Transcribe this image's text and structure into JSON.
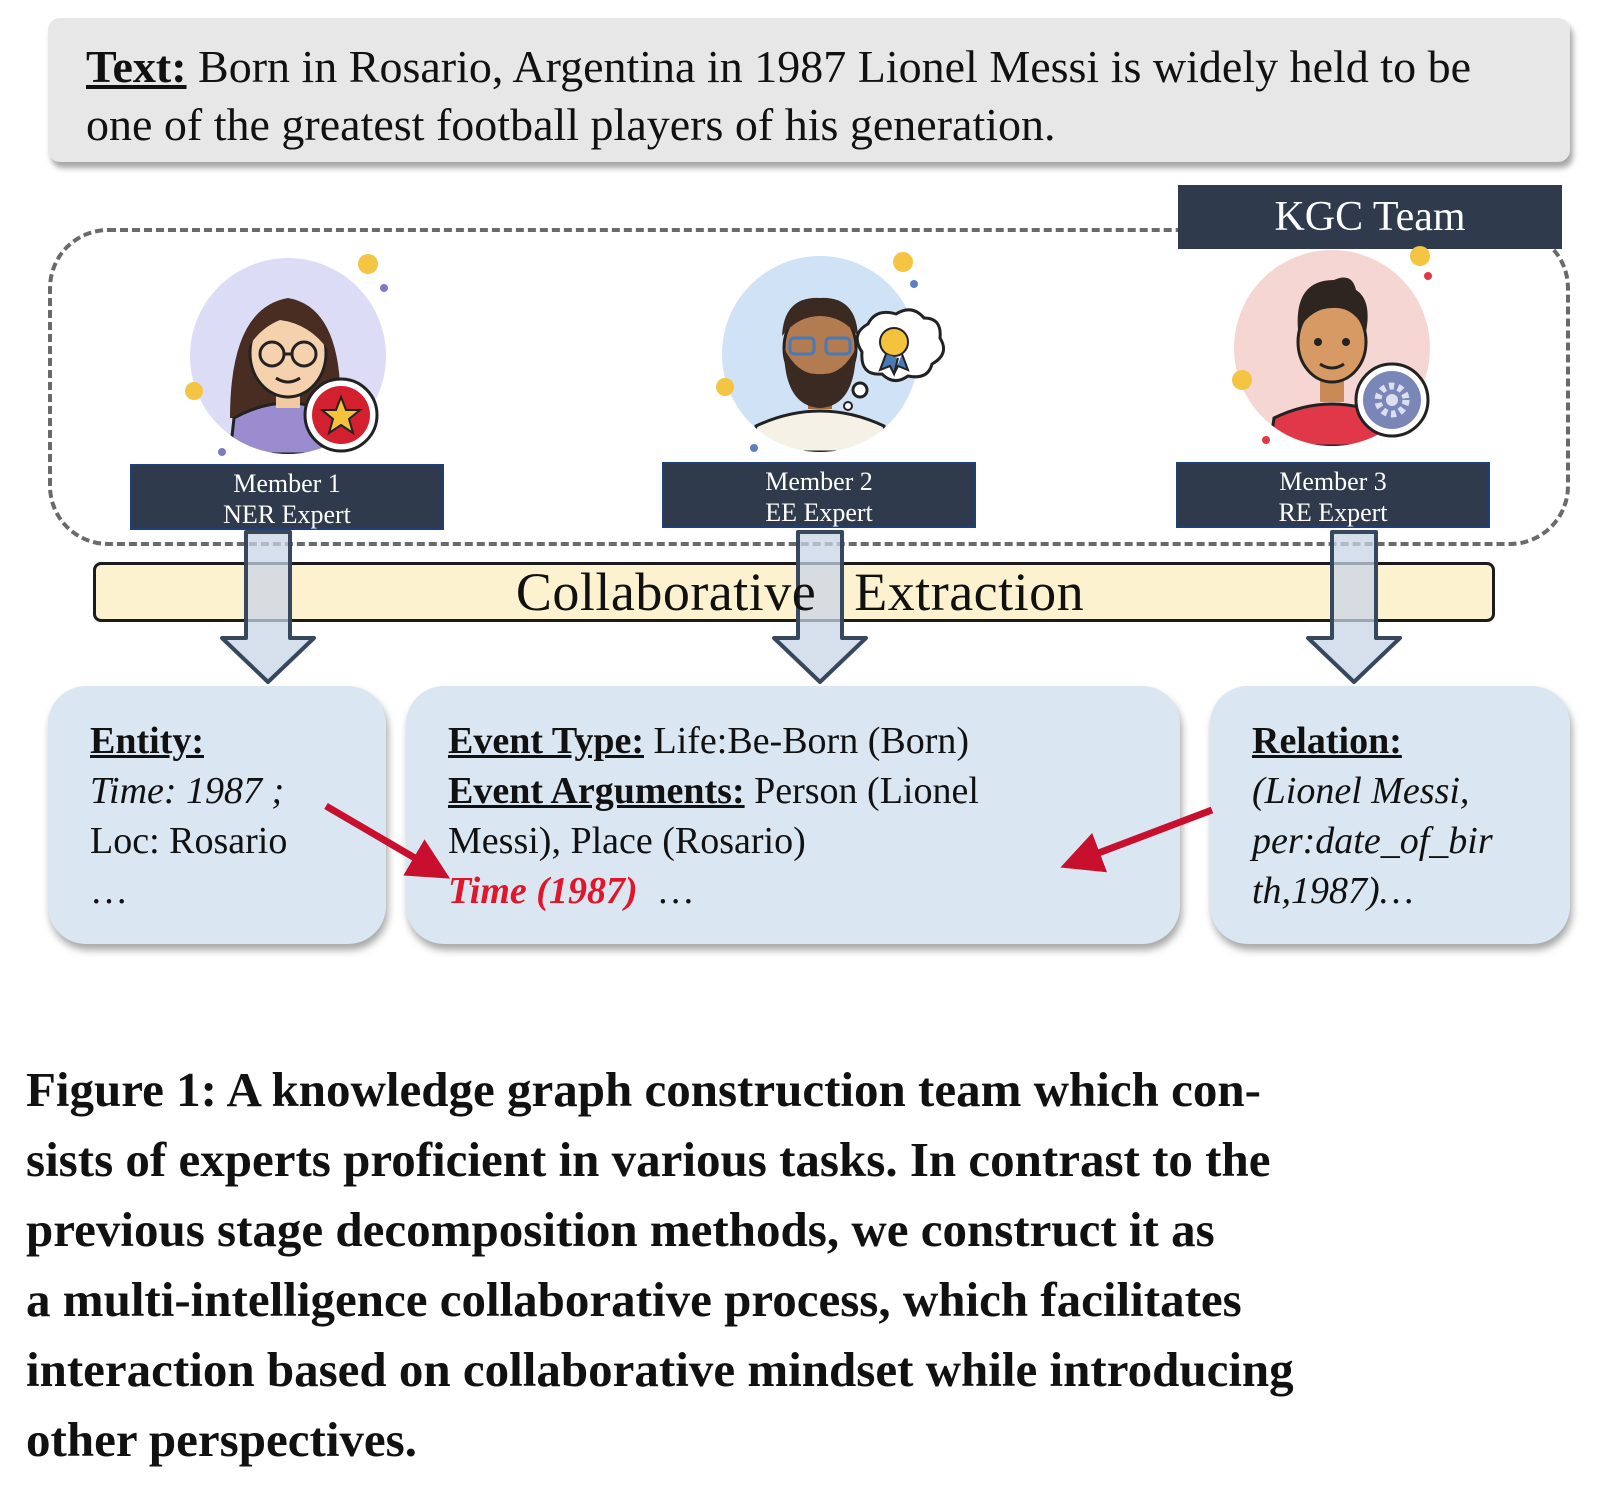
{
  "text_box": {
    "label": "Text:",
    "body": " Born in Rosario, Argentina in 1987 Lionel Messi is widely held to be one of the greatest football players of his generation."
  },
  "team": {
    "title": "KGC Team",
    "members": [
      {
        "name": "Member 1",
        "role": "NER Expert",
        "avatar_icon": "woman-with-glasses-avatar-icon",
        "badge_icon": "star-badge-icon"
      },
      {
        "name": "Member 2",
        "role": "EE Expert",
        "avatar_icon": "bearded-man-avatar-icon",
        "badge_icon": "thought-bubble-medal-icon"
      },
      {
        "name": "Member 3",
        "role": "RE Expert",
        "avatar_icon": "young-man-avatar-icon",
        "badge_icon": "gear-badge-icon"
      }
    ]
  },
  "collab_label": "Collaborative   Extraction",
  "results": {
    "entity": {
      "heading": "Entity:",
      "line1": "Time: 1987 ;",
      "line2": "Loc: Rosario",
      "line3": "…"
    },
    "event": {
      "type_label": "Event Type:",
      "type_value": " Life:Be-Born (Born)",
      "args_label": "Event Arguments:",
      "args_value": " Person (Lionel",
      "line3": "Messi), Place (Rosario)",
      "highlight": "Time (1987)",
      "ellipsis": "  …"
    },
    "relation": {
      "heading": "Relation:",
      "line1": "(Lionel Messi,",
      "line2": "per:date_of_bir",
      "line3": "th,1987)…"
    }
  },
  "caption": {
    "lines": [
      "Figure 1: A knowledge graph construction team which con-",
      "sists of experts proficient in various tasks. In contrast to the",
      "previous stage decomposition methods, we construct it as",
      "a multi-intelligence collaborative process, which facilitates",
      "interaction based on collaborative mindset while introducing",
      "other perspectives."
    ]
  },
  "colors": {
    "dark_label": "#2f3a4d",
    "collab_fill": "#fdf2d0",
    "result_fill": "#dbe6f3",
    "highlight_red": "#e0162b",
    "arrow_red": "#c8102e"
  }
}
